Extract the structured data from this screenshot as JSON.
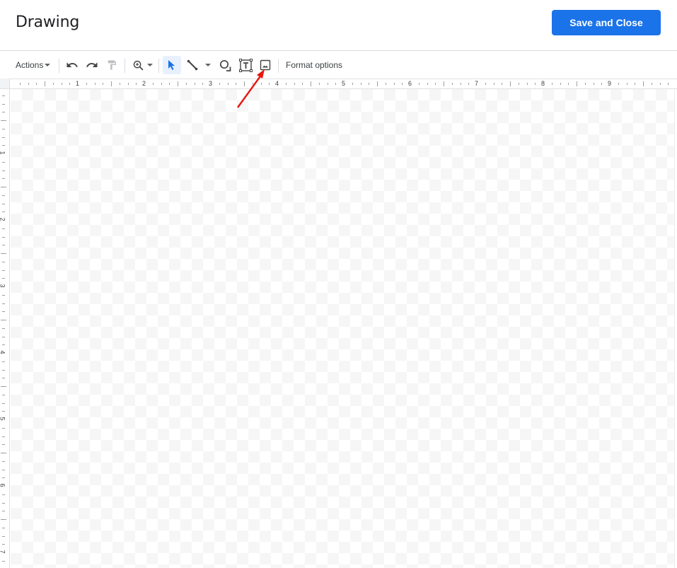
{
  "header": {
    "title": "Drawing",
    "save_label": "Save and Close",
    "accent": "#1a73e8"
  },
  "toolbar": {
    "actions_label": "Actions",
    "format_options_label": "Format options",
    "icons": [
      "undo-icon",
      "redo-icon",
      "paint-format-icon",
      "zoom-icon",
      "select-icon",
      "line-icon",
      "shape-icon",
      "text-box-icon",
      "image-icon"
    ]
  },
  "rulers": {
    "horizontal_labels": [
      "1",
      "2",
      "3",
      "4",
      "5",
      "6",
      "7",
      "8",
      "9"
    ],
    "vertical_labels": [
      "1",
      "2",
      "3",
      "4",
      "5",
      "6",
      "7"
    ]
  },
  "annotation": {
    "arrow_color": "#e8150e",
    "points_to": "image-icon"
  }
}
